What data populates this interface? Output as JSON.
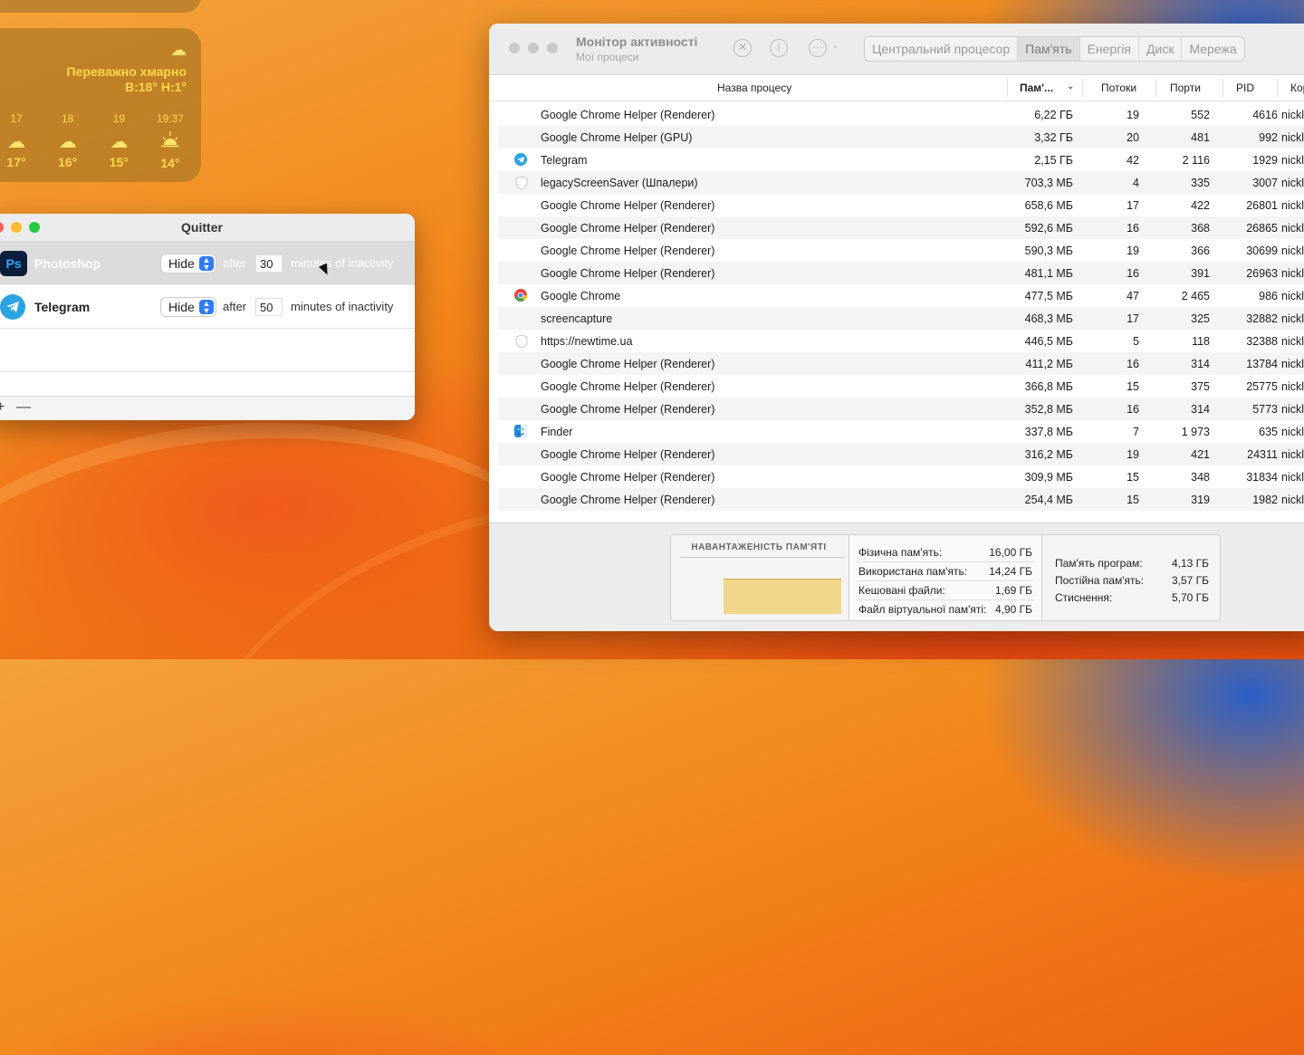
{
  "weather": {
    "condition": "Переважно хмарно",
    "high_low": "В:18° Н:1°",
    "hours": [
      {
        "time": "17",
        "icon": "cloud-icon",
        "temp": "17°"
      },
      {
        "time": "18",
        "icon": "cloud-icon",
        "temp": "16°"
      },
      {
        "time": "19",
        "icon": "cloud-icon",
        "temp": "15°"
      },
      {
        "time": "19:37",
        "icon": "sunset-icon",
        "temp": "14°"
      }
    ]
  },
  "quitter": {
    "title": "Quitter",
    "rows": [
      {
        "app": "Photoshop",
        "action": "Hide",
        "after": "after",
        "minutes": "30",
        "suffix": "minutes of inactivity"
      },
      {
        "app": "Telegram",
        "action": "Hide",
        "after": "after",
        "minutes": "50",
        "suffix": "minutes of inactivity"
      }
    ],
    "add_label": "+",
    "remove_label": "—"
  },
  "activity_monitor": {
    "title": "Монітор активності",
    "subtitle": "Мої процеси",
    "tabs": [
      "Центральний процесор",
      "Пам'ять",
      "Енергія",
      "Диск",
      "Мережа"
    ],
    "active_tab": "Пам'ять",
    "columns": {
      "name": "Назва процесу",
      "memory": "Пам'...",
      "threads": "Потоки",
      "ports": "Порти",
      "pid": "PID",
      "user": "Кор"
    },
    "processes": [
      {
        "name": "Google Chrome Helper (Renderer)",
        "memory": "6,22 ГБ",
        "threads": "19",
        "ports": "552",
        "pid": "4616",
        "user": "nickl",
        "icon": ""
      },
      {
        "name": "Google Chrome Helper (GPU)",
        "memory": "3,32 ГБ",
        "threads": "20",
        "ports": "481",
        "pid": "992",
        "user": "nickl",
        "icon": ""
      },
      {
        "name": "Telegram",
        "memory": "2,15 ГБ",
        "threads": "42",
        "ports": "2 116",
        "pid": "1929",
        "user": "nickl",
        "icon": "telegram-icon"
      },
      {
        "name": "legacyScreenSaver (Шпалери)",
        "memory": "703,3 МБ",
        "threads": "4",
        "ports": "335",
        "pid": "3007",
        "user": "nickl",
        "icon": "shield-icon"
      },
      {
        "name": "Google Chrome Helper (Renderer)",
        "memory": "658,6 МБ",
        "threads": "17",
        "ports": "422",
        "pid": "26801",
        "user": "nickl",
        "icon": ""
      },
      {
        "name": "Google Chrome Helper (Renderer)",
        "memory": "592,6 МБ",
        "threads": "16",
        "ports": "368",
        "pid": "26865",
        "user": "nickl",
        "icon": ""
      },
      {
        "name": "Google Chrome Helper (Renderer)",
        "memory": "590,3 МБ",
        "threads": "19",
        "ports": "366",
        "pid": "30699",
        "user": "nickl",
        "icon": ""
      },
      {
        "name": "Google Chrome Helper (Renderer)",
        "memory": "481,1 МБ",
        "threads": "16",
        "ports": "391",
        "pid": "26963",
        "user": "nickl",
        "icon": ""
      },
      {
        "name": "Google Chrome",
        "memory": "477,5 МБ",
        "threads": "47",
        "ports": "2 465",
        "pid": "986",
        "user": "nickl",
        "icon": "chrome-icon"
      },
      {
        "name": "screencapture",
        "memory": "468,3 МБ",
        "threads": "17",
        "ports": "325",
        "pid": "32882",
        "user": "nickl",
        "icon": ""
      },
      {
        "name": "https://newtime.ua",
        "memory": "446,5 МБ",
        "threads": "5",
        "ports": "118",
        "pid": "32388",
        "user": "nickl",
        "icon": "shield-icon"
      },
      {
        "name": "Google Chrome Helper (Renderer)",
        "memory": "411,2 МБ",
        "threads": "16",
        "ports": "314",
        "pid": "13784",
        "user": "nickl",
        "icon": ""
      },
      {
        "name": "Google Chrome Helper (Renderer)",
        "memory": "366,8 МБ",
        "threads": "15",
        "ports": "375",
        "pid": "25775",
        "user": "nickl",
        "icon": ""
      },
      {
        "name": "Google Chrome Helper (Renderer)",
        "memory": "352,8 МБ",
        "threads": "16",
        "ports": "314",
        "pid": "5773",
        "user": "nickl",
        "icon": ""
      },
      {
        "name": "Finder",
        "memory": "337,8 МБ",
        "threads": "7",
        "ports": "1 973",
        "pid": "635",
        "user": "nickl",
        "icon": "finder-icon"
      },
      {
        "name": "Google Chrome Helper (Renderer)",
        "memory": "316,2 МБ",
        "threads": "19",
        "ports": "421",
        "pid": "24311",
        "user": "nickl",
        "icon": ""
      },
      {
        "name": "Google Chrome Helper (Renderer)",
        "memory": "309,9 МБ",
        "threads": "15",
        "ports": "348",
        "pid": "31834",
        "user": "nickl",
        "icon": ""
      },
      {
        "name": "Google Chrome Helper (Renderer)",
        "memory": "254,4 МБ",
        "threads": "15",
        "ports": "319",
        "pid": "1982",
        "user": "nickl",
        "icon": ""
      }
    ],
    "memory_pressure_title": "НАВАНТАЖЕНІСТЬ ПАМ'ЯТІ",
    "memory_pressure_level": 0.62,
    "stats_left": [
      {
        "label": "Фізична пам'ять:",
        "value": "16,00 ГБ"
      },
      {
        "label": "Використана пам'ять:",
        "value": "14,24 ГБ"
      },
      {
        "label": "Кешовані файли:",
        "value": "1,69 ГБ"
      },
      {
        "label": "Файл віртуальної пам'яті:",
        "value": "4,90 ГБ"
      }
    ],
    "stats_right": [
      {
        "label": "Пам'ять програм:",
        "value": "4,13 ГБ"
      },
      {
        "label": "Постійна пам'ять:",
        "value": "3,57 ГБ"
      },
      {
        "label": "Стиснення:",
        "value": "5,70 ГБ"
      }
    ]
  },
  "colors": {
    "close": "#ff5f57",
    "minimize": "#febc2e",
    "zoom": "#28c840",
    "accent": "#2f7bf6",
    "widget_text": "#ffd84a"
  }
}
